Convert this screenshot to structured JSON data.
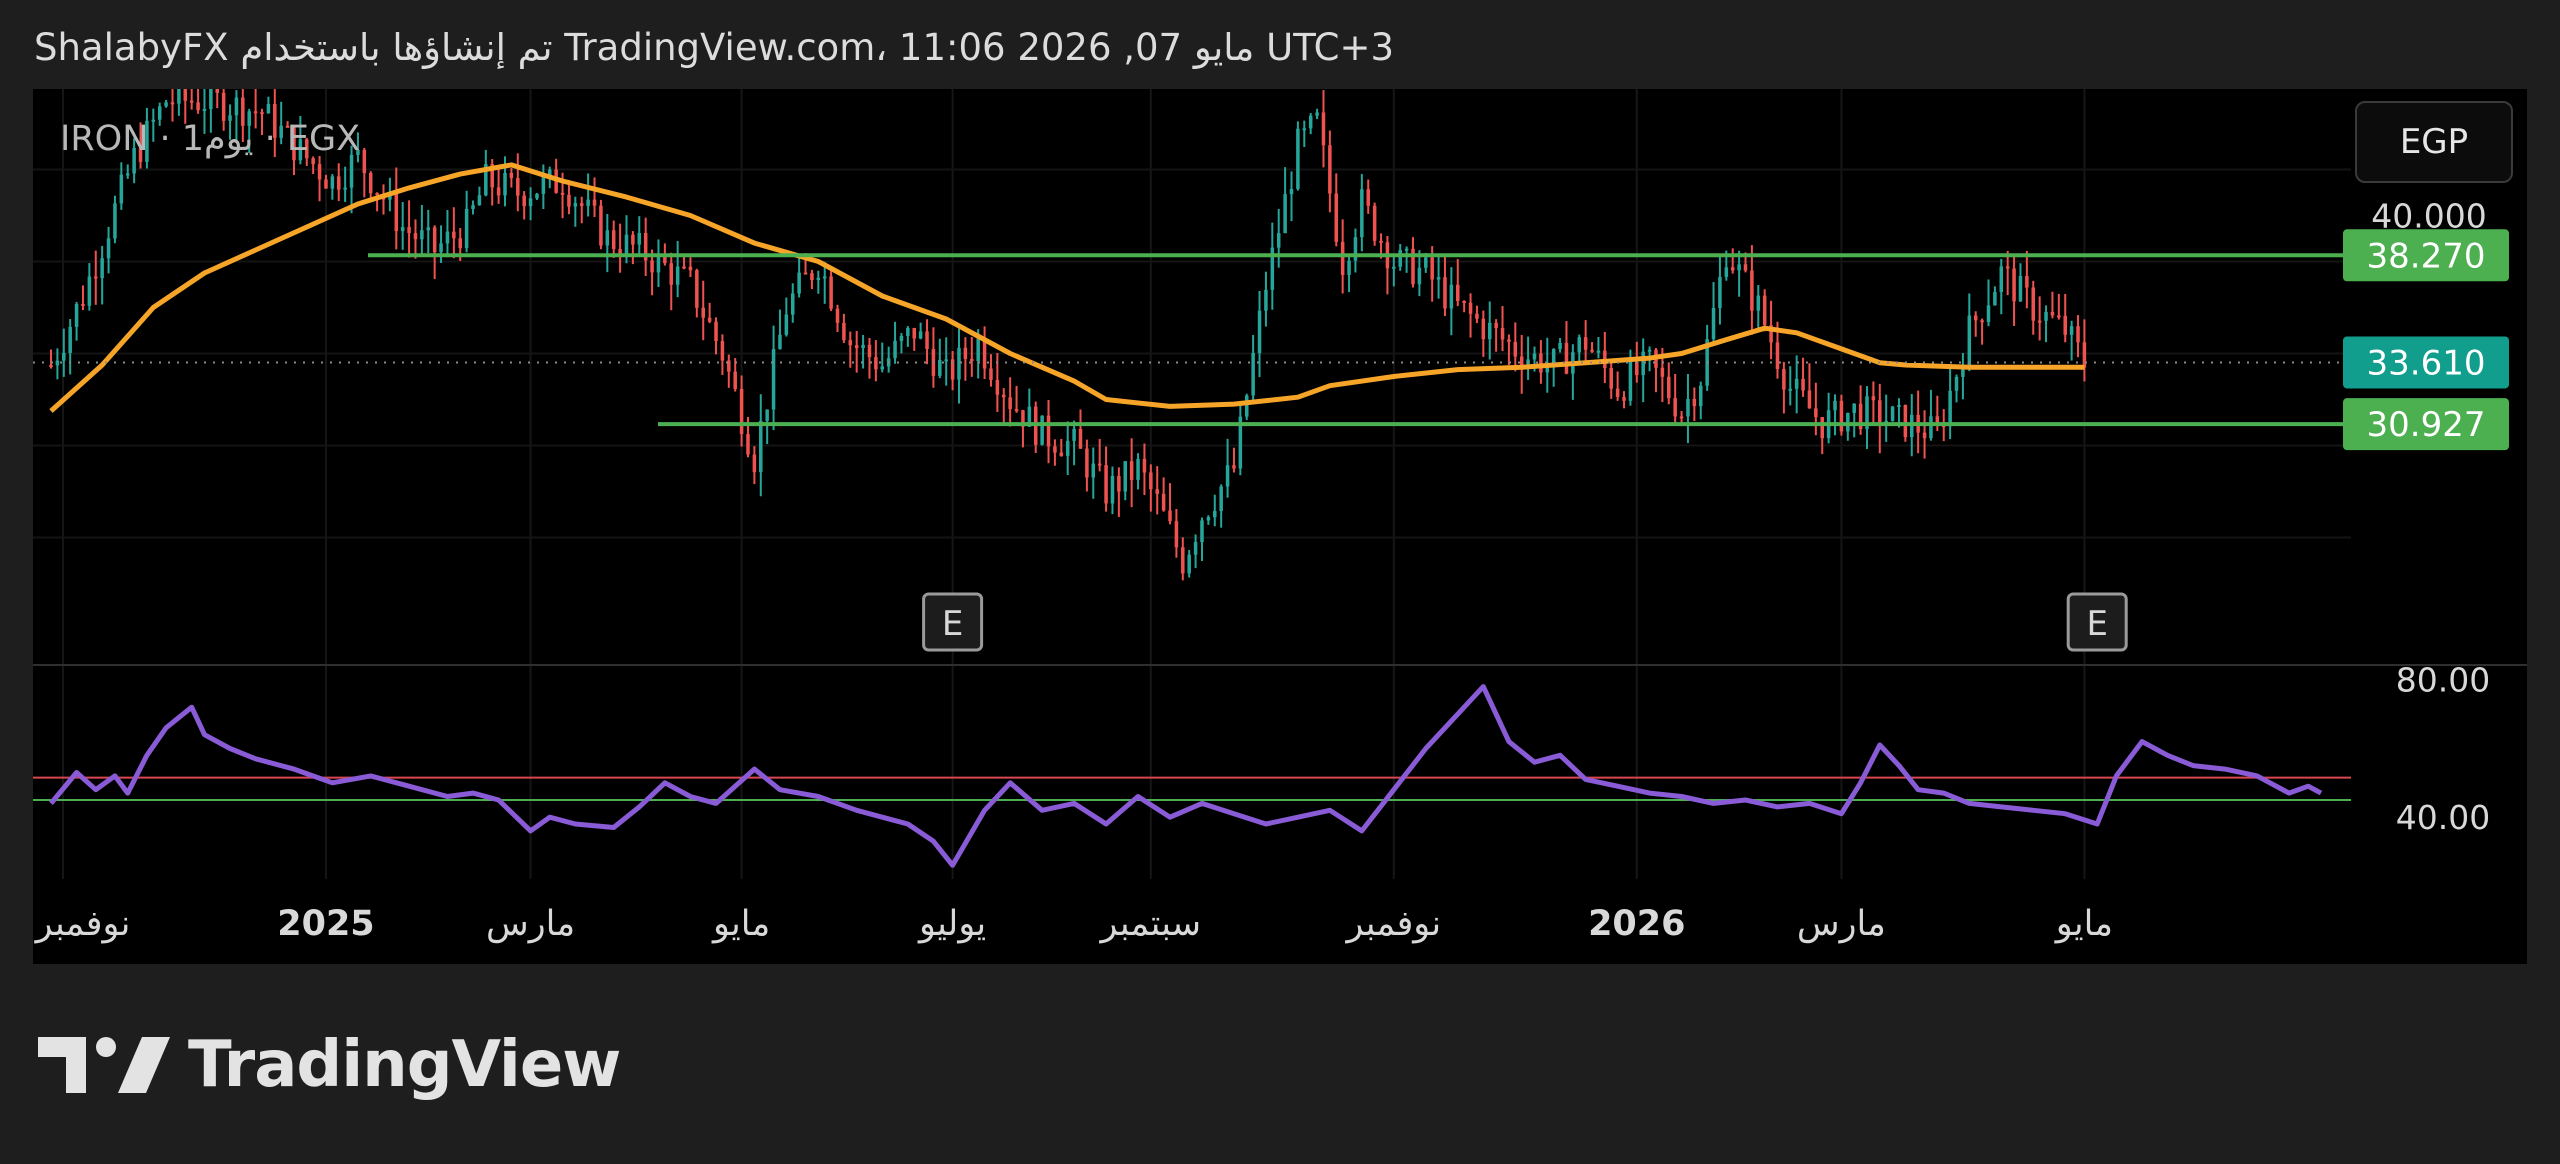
{
  "header": {
    "text": "ShalabyFX تم إنشاؤها باستخدام TradingView.com، 11:06 2026 ,07 مايو UTC+3"
  },
  "symbol": {
    "label": "IRON · 1يوم · EGX"
  },
  "currency_button": {
    "label": "EGP"
  },
  "brand": {
    "name": "TradingView",
    "icon": "tradingview-logo-icon"
  },
  "earnings_markers": [
    "E",
    "E"
  ],
  "colors": {
    "up": "#26a69a",
    "down": "#ef5350",
    "ma": "#f7a529",
    "level_line": "#4caf50",
    "level_tag": "#4caf50",
    "last_price_tag": "#129e8c",
    "rsi": "#8a5bd6",
    "rsi_upper": "#d9474f",
    "rsi_lower": "#4caf50"
  },
  "chart_data": [
    {
      "type": "candlestick",
      "x_axis_labels": [
        "نوفمبر",
        "2025",
        "مارس",
        "مايو",
        "يوليو",
        "سبتمبر",
        "نوفمبر",
        "2026",
        "مارس",
        "مايو"
      ],
      "y_tick_labels": [
        "40.000"
      ],
      "ylim": [
        20.5,
        45.5
      ],
      "grid": true,
      "levels": [
        {
          "value": 38.27,
          "label": "38.270"
        },
        {
          "value": 30.927,
          "label": "30.927"
        }
      ],
      "last_price": {
        "value": 33.61,
        "label": "33.610"
      },
      "price_path": [
        [
          0,
          33.5
        ],
        [
          5,
          36.5
        ],
        [
          9,
          39.5
        ],
        [
          13,
          42.5
        ],
        [
          18,
          45
        ],
        [
          25,
          45
        ],
        [
          33,
          44.5
        ],
        [
          40,
          42.5
        ],
        [
          44,
          41.5
        ],
        [
          48,
          42.5
        ],
        [
          55,
          39.5
        ],
        [
          60,
          38.5
        ],
        [
          65,
          39.5
        ],
        [
          68,
          41.5
        ],
        [
          73,
          41
        ],
        [
          80,
          41.5
        ],
        [
          87,
          39
        ],
        [
          92,
          38.5
        ],
        [
          100,
          37
        ],
        [
          105,
          34
        ],
        [
          110,
          29.5
        ],
        [
          115,
          36
        ],
        [
          120,
          38
        ],
        [
          125,
          34.5
        ],
        [
          130,
          33.5
        ],
        [
          135,
          35
        ],
        [
          140,
          33
        ],
        [
          145,
          34.5
        ],
        [
          150,
          32
        ],
        [
          155,
          30.5
        ],
        [
          160,
          30
        ],
        [
          165,
          28
        ],
        [
          170,
          29
        ],
        [
          173,
          27.5
        ],
        [
          177,
          25
        ],
        [
          180,
          27
        ],
        [
          185,
          29
        ],
        [
          190,
          37
        ],
        [
          195,
          43
        ],
        [
          198,
          44
        ],
        [
          202,
          38
        ],
        [
          205,
          40.5
        ],
        [
          210,
          38
        ],
        [
          215,
          37.5
        ],
        [
          220,
          36
        ],
        [
          225,
          35
        ],
        [
          230,
          34
        ],
        [
          235,
          33.5
        ],
        [
          240,
          34.5
        ],
        [
          245,
          32.5
        ],
        [
          250,
          33.5
        ],
        [
          255,
          31.5
        ],
        [
          258,
          33
        ],
        [
          262,
          38.5
        ],
        [
          267,
          36
        ],
        [
          272,
          32.5
        ],
        [
          277,
          31
        ],
        [
          282,
          31.5
        ],
        [
          290,
          31
        ],
        [
          295,
          30.5
        ],
        [
          300,
          35
        ],
        [
          305,
          37.5
        ],
        [
          310,
          36
        ],
        [
          315,
          35
        ],
        [
          318,
          33.6
        ]
      ],
      "moving_average": [
        [
          0,
          31.5
        ],
        [
          8,
          33.5
        ],
        [
          16,
          36
        ],
        [
          24,
          37.5
        ],
        [
          32,
          38.5
        ],
        [
          40,
          39.5
        ],
        [
          48,
          40.5
        ],
        [
          56,
          41.2
        ],
        [
          64,
          41.8
        ],
        [
          72,
          42.2
        ],
        [
          80,
          41.5
        ],
        [
          90,
          40.8
        ],
        [
          100,
          40
        ],
        [
          110,
          38.8
        ],
        [
          120,
          38
        ],
        [
          130,
          36.5
        ],
        [
          140,
          35.5
        ],
        [
          150,
          34
        ],
        [
          160,
          32.8
        ],
        [
          165,
          32
        ],
        [
          175,
          31.7
        ],
        [
          185,
          31.8
        ],
        [
          195,
          32.1
        ],
        [
          200,
          32.6
        ],
        [
          210,
          33
        ],
        [
          220,
          33.3
        ],
        [
          230,
          33.4
        ],
        [
          240,
          33.6
        ],
        [
          250,
          33.8
        ],
        [
          255,
          34
        ],
        [
          262,
          34.6
        ],
        [
          268,
          35.1
        ],
        [
          273,
          34.9
        ],
        [
          280,
          34.2
        ],
        [
          286,
          33.6
        ],
        [
          290,
          33.5
        ],
        [
          300,
          33.4
        ],
        [
          310,
          33.4
        ],
        [
          318,
          33.4
        ]
      ]
    },
    {
      "type": "line",
      "name": "RSI",
      "y_tick_labels": [
        "80.00",
        "40.00"
      ],
      "ylim": [
        22,
        84
      ],
      "bands": [
        51.5,
        45
      ],
      "values": [
        [
          0,
          44
        ],
        [
          4,
          53
        ],
        [
          7,
          48
        ],
        [
          10,
          52
        ],
        [
          12,
          47
        ],
        [
          15,
          58
        ],
        [
          18,
          66
        ],
        [
          20,
          69
        ],
        [
          22,
          72
        ],
        [
          24,
          64
        ],
        [
          28,
          60
        ],
        [
          32,
          57
        ],
        [
          38,
          54
        ],
        [
          44,
          50
        ],
        [
          50,
          52
        ],
        [
          56,
          49
        ],
        [
          62,
          46
        ],
        [
          66,
          47
        ],
        [
          70,
          45
        ],
        [
          75,
          36
        ],
        [
          78,
          40
        ],
        [
          82,
          38
        ],
        [
          88,
          37
        ],
        [
          92,
          43
        ],
        [
          96,
          50
        ],
        [
          100,
          46
        ],
        [
          104,
          44
        ],
        [
          110,
          54
        ],
        [
          114,
          48
        ],
        [
          120,
          46
        ],
        [
          126,
          42
        ],
        [
          130,
          40
        ],
        [
          134,
          38
        ],
        [
          138,
          33
        ],
        [
          141,
          26
        ],
        [
          146,
          42
        ],
        [
          150,
          50
        ],
        [
          155,
          42
        ],
        [
          160,
          44
        ],
        [
          165,
          38
        ],
        [
          170,
          46
        ],
        [
          175,
          40
        ],
        [
          180,
          44
        ],
        [
          185,
          41
        ],
        [
          190,
          38
        ],
        [
          195,
          40
        ],
        [
          200,
          42
        ],
        [
          205,
          36
        ],
        [
          210,
          48
        ],
        [
          215,
          60
        ],
        [
          220,
          70
        ],
        [
          224,
          78
        ],
        [
          228,
          62
        ],
        [
          232,
          56
        ],
        [
          236,
          58
        ],
        [
          240,
          51
        ],
        [
          245,
          49
        ],
        [
          250,
          47
        ],
        [
          255,
          46
        ],
        [
          260,
          44
        ],
        [
          265,
          45
        ],
        [
          270,
          43
        ],
        [
          275,
          44
        ],
        [
          280,
          41
        ],
        [
          283,
          50
        ],
        [
          286,
          61
        ],
        [
          289,
          55
        ],
        [
          292,
          48
        ],
        [
          296,
          47
        ],
        [
          300,
          44
        ],
        [
          305,
          43
        ],
        [
          310,
          42
        ],
        [
          315,
          41
        ],
        [
          320,
          38
        ],
        [
          323,
          52
        ],
        [
          327,
          62
        ],
        [
          331,
          58
        ],
        [
          335,
          55
        ],
        [
          340,
          54
        ],
        [
          345,
          52
        ],
        [
          350,
          47
        ],
        [
          353,
          49
        ],
        [
          355,
          47
        ]
      ]
    }
  ]
}
